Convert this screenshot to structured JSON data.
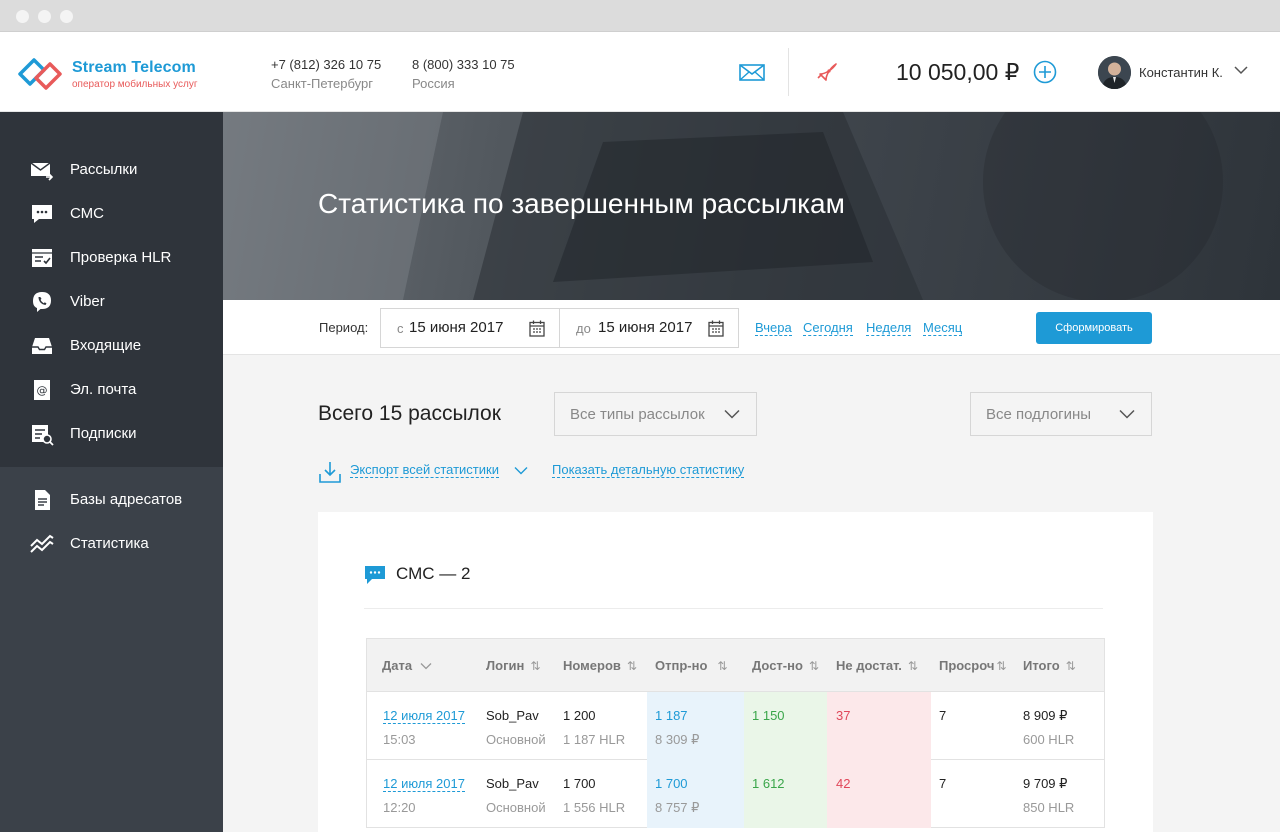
{
  "header": {
    "brand": "Stream Telecom",
    "tagline": "оператор мобильных услуг",
    "phones": [
      {
        "number": "+7 (812) 326 10 75",
        "city": "Санкт-Петербург"
      },
      {
        "number": "8 (800) 333 10 75",
        "city": "Россия"
      }
    ],
    "balance": "10 050,00 ₽",
    "user_name": "Константин К."
  },
  "sidebar": {
    "items": [
      {
        "label": "Рассылки",
        "icon": "envelope-send-icon"
      },
      {
        "label": "СМС",
        "icon": "chat-bubble-icon"
      },
      {
        "label": "Проверка HLR",
        "icon": "checklist-icon"
      },
      {
        "label": "Viber",
        "icon": "viber-icon"
      },
      {
        "label": "Входящие",
        "icon": "inbox-icon"
      },
      {
        "label": "Эл. почта",
        "icon": "email-at-icon"
      },
      {
        "label": "Подписки",
        "icon": "subscriptions-icon"
      },
      {
        "label": "Базы адресатов",
        "icon": "document-list-icon"
      },
      {
        "label": "Статистика",
        "icon": "stats-chart-icon"
      }
    ]
  },
  "banner": {
    "title": "Статистика по завершенным рассылкам"
  },
  "period": {
    "label": "Период:",
    "from_prefix": "с",
    "from_value": "15 июня 2017",
    "to_prefix": "до",
    "to_value": "15 июня 2017",
    "quick": [
      "Вчера",
      "Сегодня",
      "Неделя",
      "Месяц"
    ],
    "submit": "Сформировать"
  },
  "summary": {
    "total": "Всего 15 рассылок",
    "type_select": "Все типы рассылок",
    "login_select": "Все подлогины",
    "export_link": "Экспорт всей статистики",
    "detail_link": "Показать детальную статистику"
  },
  "section": {
    "title": "СМС — 2",
    "columns": [
      "Дата",
      "Логин",
      "Номеров",
      "Отпр-но",
      "Дост-но",
      "Не достат.",
      "Просроч",
      "Итого"
    ],
    "rows": [
      {
        "date": "12 июля 2017",
        "time": "15:03",
        "login": "Sob_Pav",
        "login_sub": "Основной",
        "numbers": "1 200",
        "numbers_sub": "1 187 HLR",
        "sent": "1 187",
        "sent_sub": "8 309 ₽",
        "delivered": "1 150",
        "not_delivered": "37",
        "expired": "7",
        "total": "8 909 ₽",
        "total_sub": "600 HLR"
      },
      {
        "date": "12 июля 2017",
        "time": "12:20",
        "login": "Sob_Pav",
        "login_sub": "Основной",
        "numbers": "1 700",
        "numbers_sub": "1 556 HLR",
        "sent": "1 700",
        "sent_sub": "8 757 ₽",
        "delivered": "1 612",
        "not_delivered": "42",
        "expired": "7",
        "total": "9 709 ₽",
        "total_sub": "850 HLR"
      }
    ]
  },
  "colors": {
    "accent": "#1e9ad6",
    "sidebar": "#3b4149",
    "sidebar_top": "#2f343b",
    "danger": "#e0475a",
    "success": "#3aa64a"
  }
}
